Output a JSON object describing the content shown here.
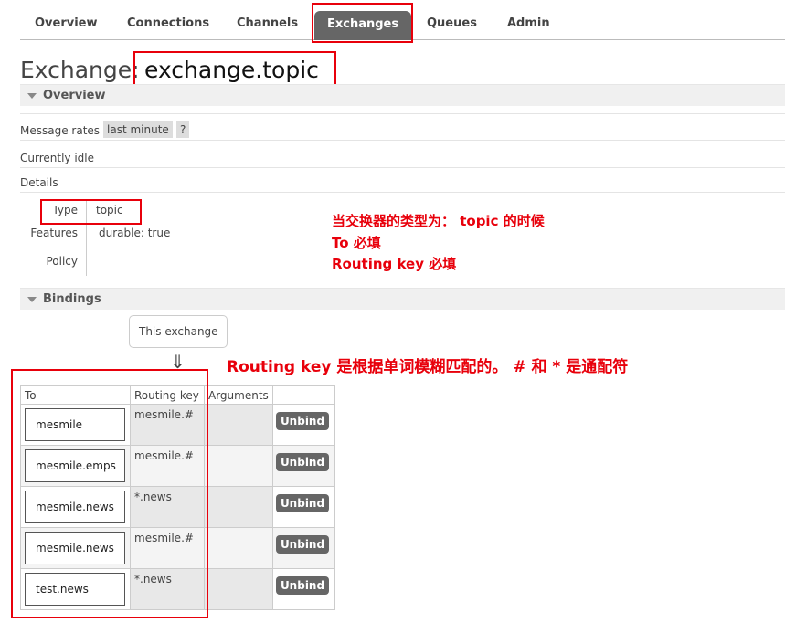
{
  "nav": {
    "items": [
      "Overview",
      "Connections",
      "Channels",
      "Exchanges",
      "Queues",
      "Admin"
    ],
    "active": "Exchanges"
  },
  "title": {
    "prefix": "Exchange:",
    "name": "exchange.topic"
  },
  "overview": {
    "section_label": "Overview",
    "message_rates_label": "Message rates",
    "message_rates_value": "last minute",
    "help": "?",
    "idle": "Currently idle",
    "details_label": "Details",
    "details": {
      "type_label": "Type",
      "type_value": "topic",
      "features_label": "Features",
      "features_key": "durable:",
      "features_value": "true",
      "policy_label": "Policy"
    }
  },
  "annotations": {
    "line1": "当交换器的类型为：  topic 的时候",
    "line2": "To 必填",
    "line3": "Routing key 必填",
    "line4": "Routing key 是根据单词模糊匹配的。 # 和 * 是通配符"
  },
  "bindings": {
    "section_label": "Bindings",
    "this_exchange": "This exchange",
    "arrow": "⇓",
    "columns": [
      "To",
      "Routing key",
      "Arguments",
      ""
    ],
    "rows": [
      {
        "to": "mesmile",
        "routing_key": "mesmile.#",
        "action": "Unbind"
      },
      {
        "to": "mesmile.emps",
        "routing_key": "mesmile.#",
        "action": "Unbind"
      },
      {
        "to": "mesmile.news",
        "routing_key": "*.news",
        "action": "Unbind"
      },
      {
        "to": "mesmile.news",
        "routing_key": "mesmile.#",
        "action": "Unbind"
      },
      {
        "to": "test.news",
        "routing_key": "*.news",
        "action": "Unbind"
      }
    ]
  },
  "colors": {
    "highlight_red": "#e8000b",
    "nav_active_bg": "#666666"
  }
}
